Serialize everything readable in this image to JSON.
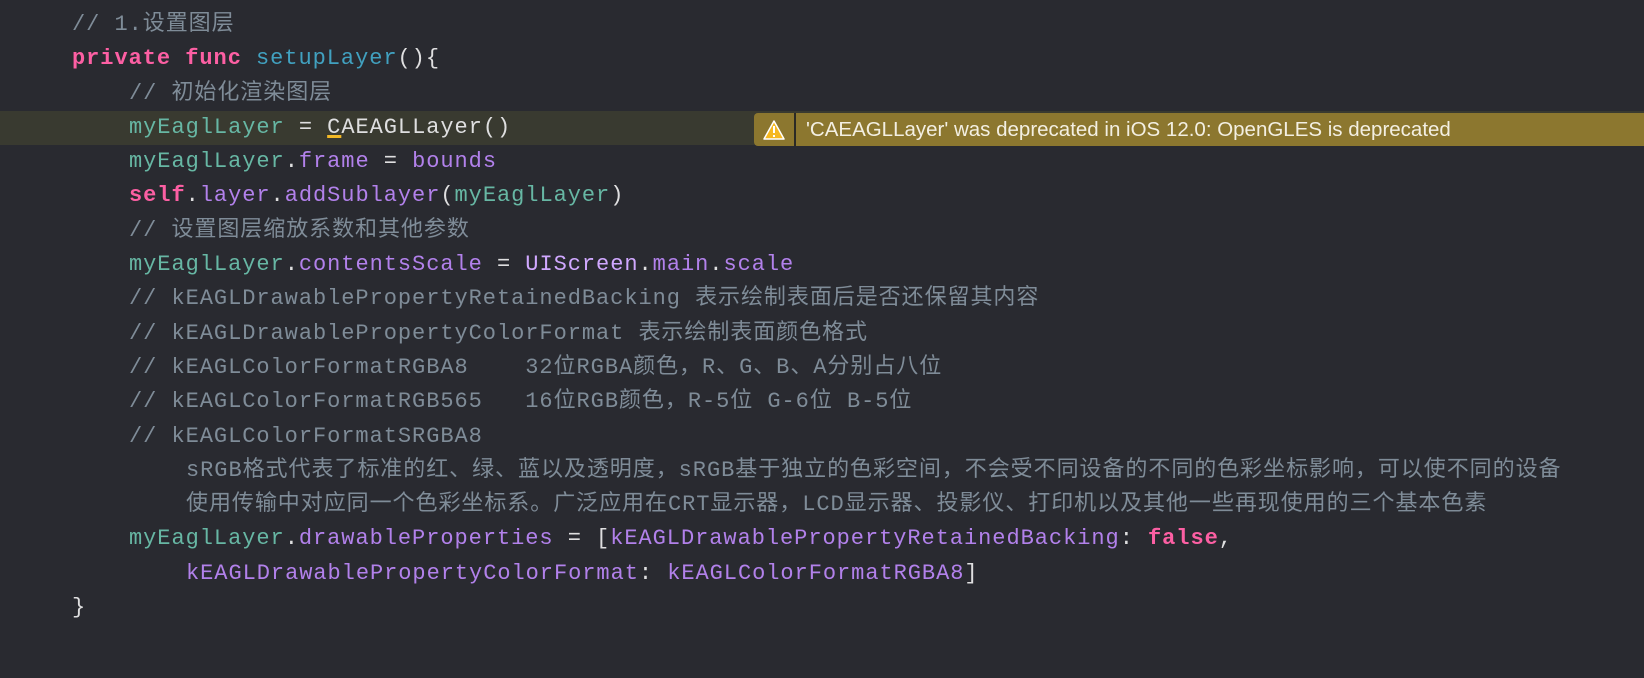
{
  "editor": {
    "highlighted_line": 3,
    "lines": [
      {
        "indent": 0,
        "tokens": [
          [
            "// 1.设置图层",
            "comment"
          ]
        ]
      },
      {
        "indent": 0,
        "tokens": [
          [
            "private",
            "kw"
          ],
          [
            " ",
            "plain"
          ],
          [
            "func",
            "kw"
          ],
          [
            " ",
            "plain"
          ],
          [
            "setupLayer",
            "fn"
          ],
          [
            "(){",
            "plain"
          ]
        ]
      },
      {
        "indent": 1,
        "tokens": [
          [
            "// 初始化渲染图层",
            "comment"
          ]
        ]
      },
      {
        "indent": 1,
        "tokens": [
          [
            "myEaglLayer",
            "var"
          ],
          [
            " = ",
            "plain"
          ],
          [
            "C",
            "err"
          ],
          [
            "AEAGLLayer()",
            "plain"
          ]
        ]
      },
      {
        "indent": 1,
        "tokens": [
          [
            "myEaglLayer",
            "var"
          ],
          [
            ".",
            "plain"
          ],
          [
            "frame",
            "prop"
          ],
          [
            " = ",
            "plain"
          ],
          [
            "bounds",
            "prop"
          ]
        ]
      },
      {
        "indent": 1,
        "tokens": [
          [
            "self",
            "kw"
          ],
          [
            ".",
            "plain"
          ],
          [
            "layer",
            "prop"
          ],
          [
            ".",
            "plain"
          ],
          [
            "addSublayer",
            "prop"
          ],
          [
            "(",
            "plain"
          ],
          [
            "myEaglLayer",
            "var"
          ],
          [
            ")",
            "plain"
          ]
        ]
      },
      {
        "indent": 1,
        "tokens": [
          [
            "// 设置图层缩放系数和其他参数",
            "comment"
          ]
        ]
      },
      {
        "indent": 1,
        "tokens": [
          [
            "myEaglLayer",
            "var"
          ],
          [
            ".",
            "plain"
          ],
          [
            "contentsScale",
            "prop"
          ],
          [
            " = ",
            "plain"
          ],
          [
            "UIScreen",
            "sys"
          ],
          [
            ".",
            "plain"
          ],
          [
            "main",
            "prop"
          ],
          [
            ".",
            "plain"
          ],
          [
            "scale",
            "prop"
          ]
        ]
      },
      {
        "indent": 1,
        "tokens": [
          [
            "// kEAGLDrawablePropertyRetainedBacking 表示绘制表面后是否还保留其内容",
            "comment"
          ]
        ]
      },
      {
        "indent": 1,
        "tokens": [
          [
            "// kEAGLDrawablePropertyColorFormat 表示绘制表面颜色格式",
            "comment"
          ]
        ]
      },
      {
        "indent": 1,
        "tokens": [
          [
            "// kEAGLColorFormatRGBA8    32位RGBA颜色，R、G、B、A分别占八位",
            "comment"
          ]
        ]
      },
      {
        "indent": 1,
        "tokens": [
          [
            "// kEAGLColorFormatRGB565   16位RGB颜色，R-5位 G-6位 B-5位",
            "comment"
          ]
        ]
      },
      {
        "indent": 1,
        "tokens": [
          [
            "// kEAGLColorFormatSRGBA8",
            "comment"
          ]
        ]
      },
      {
        "indent": 2,
        "tokens": [
          [
            "sRGB格式代表了标准的红、绿、蓝以及透明度，sRGB基于独立的色彩空间，不会受不同设备的不同的色彩坐标影响，可以使不同的设备",
            "comment"
          ]
        ]
      },
      {
        "indent": 2,
        "tokens": [
          [
            "使用传输中对应同一个色彩坐标系。广泛应用在CRT显示器，LCD显示器、投影仪、打印机以及其他一些再现使用的三个基本色素",
            "comment"
          ]
        ]
      },
      {
        "indent": 1,
        "tokens": [
          [
            "myEaglLayer",
            "var"
          ],
          [
            ".",
            "plain"
          ],
          [
            "drawableProperties",
            "prop"
          ],
          [
            " = [",
            "plain"
          ],
          [
            "kEAGLDrawablePropertyRetainedBacking",
            "prop"
          ],
          [
            ": ",
            "plain"
          ],
          [
            "false",
            "kw"
          ],
          [
            ",",
            "plain"
          ]
        ]
      },
      {
        "indent": 2,
        "tokens": [
          [
            "kEAGLDrawablePropertyColorFormat",
            "prop"
          ],
          [
            ": ",
            "plain"
          ],
          [
            "kEAGLColorFormatRGBA8",
            "prop"
          ],
          [
            "]",
            "plain"
          ]
        ]
      },
      {
        "indent": 0,
        "tokens": [
          [
            "}",
            "plain"
          ]
        ]
      }
    ]
  },
  "warning": {
    "icon": "warning-triangle-icon",
    "message": "'CAEAGLLayer' was deprecated in iOS 12.0: OpenGLES is deprecated"
  }
}
